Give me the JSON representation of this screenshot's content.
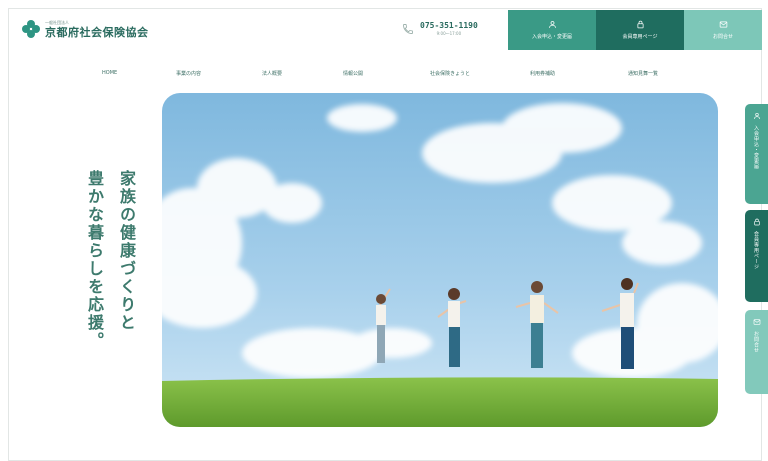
{
  "header": {
    "logo_sub": "一般社団法人",
    "logo_name": "京都府社会保険協会",
    "phone_number": "075-351-1190",
    "phone_hours": "9:00〜17:00",
    "buttons": {
      "join": "入会申込・変更届",
      "member": "会員専用ページ",
      "contact": "お問合せ"
    }
  },
  "nav": {
    "items": [
      "HOME",
      "事業の内容",
      "法人概要",
      "情報公開",
      "社会保険きょうと",
      "利用券補助",
      "通知見舞一覧"
    ]
  },
  "hero": {
    "catch_line1": "家族の健康づくりと",
    "catch_line2": "豊かな暮らしを応援。"
  },
  "side_tabs": {
    "join": "入会申込・変更届",
    "member": "会員専用ページ",
    "contact": "お問合せ"
  },
  "colors": {
    "brand": "#2e9583",
    "brand_dark": "#1f6d5f",
    "brand_light": "#7dc7b8"
  },
  "icons": {
    "logo": "clover-icon",
    "phone": "phone-icon",
    "join": "person-icon",
    "member": "lock-icon",
    "contact": "mail-icon"
  }
}
